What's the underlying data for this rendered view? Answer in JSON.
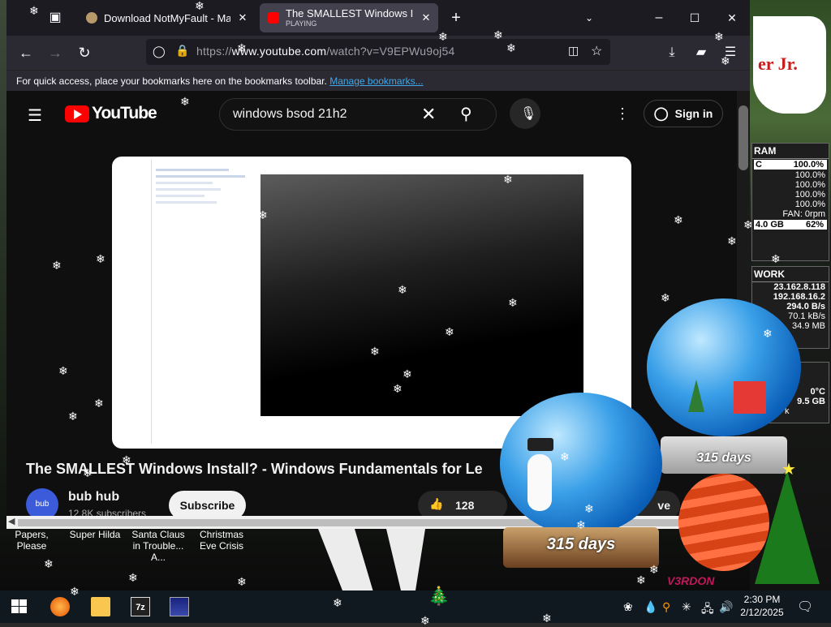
{
  "browser": {
    "tabs": [
      {
        "title": "Download NotMyFault - MajorG",
        "sub": ""
      },
      {
        "title": "The SMALLEST Windows Install",
        "sub": "PLAYING"
      }
    ],
    "url_prefix": "https://",
    "url_host": "www.youtube.com",
    "url_path": "/watch?v=V9EPWu9oj54",
    "bookmarks_text": "For quick access, place your bookmarks here on the bookmarks toolbar.",
    "bookmarks_link": "Manage bookmarks..."
  },
  "youtube": {
    "logo_text": "YouTube",
    "search_value": "windows bsod 21h2",
    "sign_in": "Sign in",
    "video_title": "The SMALLEST Windows Install? - Windows Fundamentals for Le",
    "channel_name": "bub hub",
    "avatar_text": "bub",
    "subscribers": "12.8K subscribers",
    "subscribe": "Subscribe",
    "likes": "128",
    "save_partial": "ve"
  },
  "desktop": {
    "icons": [
      {
        "label": "Papers, Please"
      },
      {
        "label": "Super Hilda"
      },
      {
        "label": "Santa Claus in Trouble... A..."
      },
      {
        "label": "Christmas Eve Crisis"
      }
    ],
    "sign_text": "er Jr.",
    "ram_panel": {
      "title": "RAM",
      "rows": [
        "100.0%",
        "100.0%",
        "100.0%",
        "100.0%",
        "100.0%"
      ],
      "fan": "FAN: 0rpm",
      "mem": "4.0 GB",
      "mem_pct": "62%",
      "partial_c": "C"
    },
    "network_panel": {
      "title": "WORK",
      "rows": [
        "23.162.8.118",
        "192.168.16.2",
        "294.0 B/s",
        "70.1 kB/s",
        "34.9 MB"
      ]
    },
    "temp_panel": {
      "rows": [
        "0°C",
        "9.5 GB",
        "k"
      ]
    },
    "globe_big_label": "315 days",
    "globe_small_label": "315 days",
    "watermark": "V3RDON"
  },
  "taskbar": {
    "time": "2:30 PM",
    "date": "2/12/2025"
  }
}
